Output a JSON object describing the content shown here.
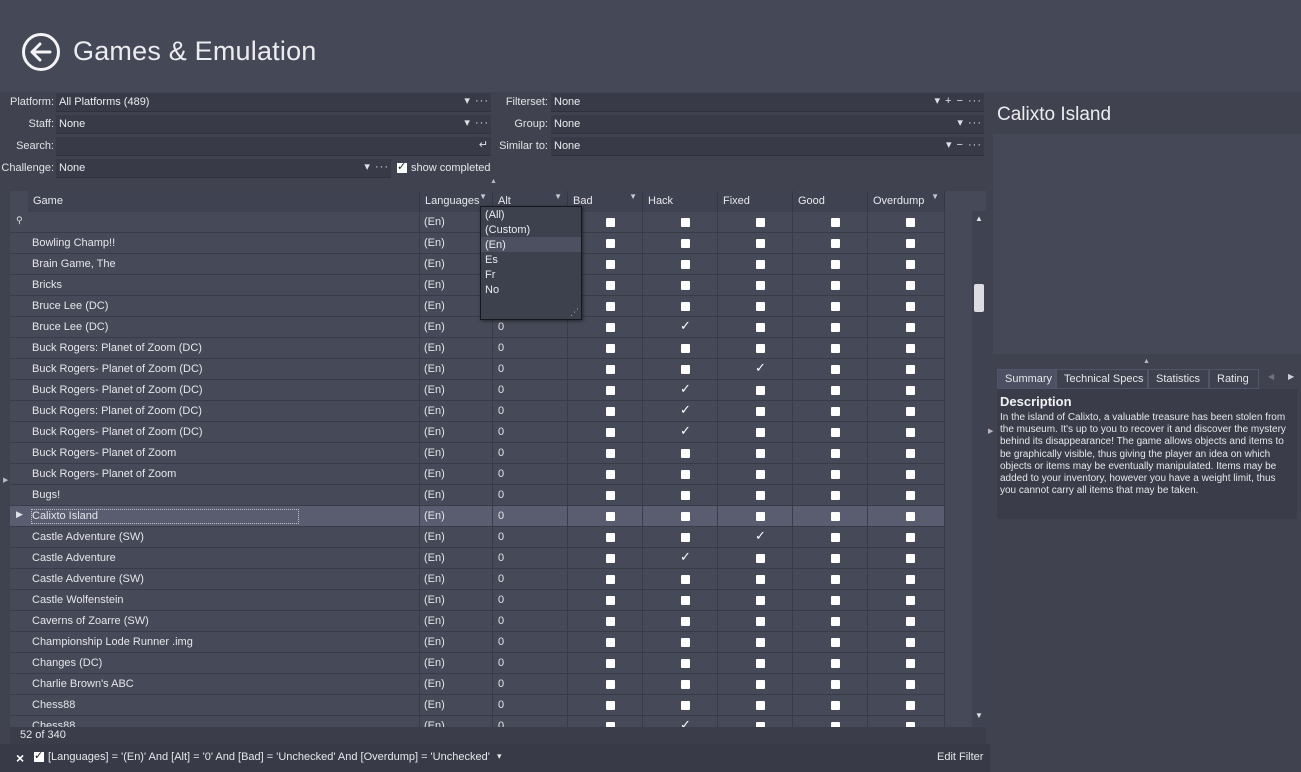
{
  "header": {
    "title": "Games & Emulation"
  },
  "filters": {
    "platform_label": "Platform:",
    "platform_value": "All Platforms (489)",
    "staff_label": "Staff:",
    "staff_value": "None",
    "search_label": "Search:",
    "search_value": "",
    "challenge_label": "Challenge:",
    "challenge_value": "None",
    "show_completed_label": "show completed",
    "filterset_label": "Filterset:",
    "filterset_value": "None",
    "group_label": "Group:",
    "group_value": "None",
    "similar_label": "Similar to:",
    "similar_value": "None"
  },
  "columns": [
    "Game",
    "Languages",
    "Alt",
    "Bad",
    "Hack",
    "Fixed",
    "Good",
    "Overdump"
  ],
  "filter_row_language": "(En)",
  "rows": [
    {
      "game": "Bowling Champ!!",
      "lang": "(En)",
      "alt": "0",
      "checks": []
    },
    {
      "game": "Brain Game, The",
      "lang": "(En)",
      "alt": "0",
      "checks": []
    },
    {
      "game": "Bricks",
      "lang": "(En)",
      "alt": "0",
      "checks": []
    },
    {
      "game": "Bruce Lee (DC)",
      "lang": "(En)",
      "alt": "0",
      "checks": []
    },
    {
      "game": "Bruce Lee (DC)",
      "lang": "(En)",
      "alt": "0",
      "checks": [
        "hack"
      ]
    },
    {
      "game": "Buck Rogers: Planet of Zoom (DC)",
      "lang": "(En)",
      "alt": "0",
      "checks": []
    },
    {
      "game": "Buck Rogers- Planet of Zoom (DC)",
      "lang": "(En)",
      "alt": "0",
      "checks": [
        "fixed"
      ]
    },
    {
      "game": "Buck Rogers- Planet of Zoom (DC)",
      "lang": "(En)",
      "alt": "0",
      "checks": [
        "hack"
      ]
    },
    {
      "game": "Buck Rogers: Planet of Zoom (DC)",
      "lang": "(En)",
      "alt": "0",
      "checks": [
        "hack"
      ]
    },
    {
      "game": "Buck Rogers- Planet of Zoom (DC)",
      "lang": "(En)",
      "alt": "0",
      "checks": [
        "hack"
      ]
    },
    {
      "game": "Buck Rogers- Planet of Zoom",
      "lang": "(En)",
      "alt": "0",
      "checks": []
    },
    {
      "game": "Buck Rogers- Planet of Zoom",
      "lang": "(En)",
      "alt": "0",
      "checks": []
    },
    {
      "game": "Bugs!",
      "lang": "(En)",
      "alt": "0",
      "checks": []
    },
    {
      "game": "Calixto Island",
      "lang": "(En)",
      "alt": "0",
      "checks": [],
      "selected": true
    },
    {
      "game": "Castle Adventure (SW)",
      "lang": "(En)",
      "alt": "0",
      "checks": [
        "fixed"
      ]
    },
    {
      "game": "Castle Adventure",
      "lang": "(En)",
      "alt": "0",
      "checks": [
        "hack"
      ]
    },
    {
      "game": "Castle Adventure (SW)",
      "lang": "(En)",
      "alt": "0",
      "checks": []
    },
    {
      "game": "Castle Wolfenstein",
      "lang": "(En)",
      "alt": "0",
      "checks": []
    },
    {
      "game": "Caverns of Zoarre (SW)",
      "lang": "(En)",
      "alt": "0",
      "checks": []
    },
    {
      "game": "Championship Lode Runner  .img",
      "lang": "(En)",
      "alt": "0",
      "checks": []
    },
    {
      "game": "Changes (DC)",
      "lang": "(En)",
      "alt": "0",
      "checks": []
    },
    {
      "game": "Charlie Brown's ABC",
      "lang": "(En)",
      "alt": "0",
      "checks": []
    },
    {
      "game": "Chess88",
      "lang": "(En)",
      "alt": "0",
      "checks": []
    },
    {
      "game": "Chess88",
      "lang": "(En)",
      "alt": "0",
      "checks": [
        "hack"
      ]
    }
  ],
  "language_dropdown": [
    "(All)",
    "(Custom)",
    "(En)",
    "Es",
    "Fr",
    "No"
  ],
  "status": {
    "count": "52 of 340"
  },
  "filter_bar": {
    "expression": "[Languages] = '(En)' And [Alt] = '0' And [Bad] = 'Unchecked' And [Overdump] = 'Unchecked'",
    "edit_label": "Edit Filter"
  },
  "detail": {
    "title": "Calixto Island",
    "tabs": [
      "Summary",
      "Technical Specs",
      "Statistics",
      "Rating"
    ],
    "description_heading": "Description",
    "description": "In the island of Calixto, a valuable treasure has been stolen from the museum. It's up to you to recover it and discover the mystery behind its disappearance! The game allows objects and items to be graphically visible, thus giving the player an idea on which objects or items may be eventually manipulated. Items may be added to your inventory, however you have a weight limit, thus you cannot carry all items that may be taken."
  }
}
